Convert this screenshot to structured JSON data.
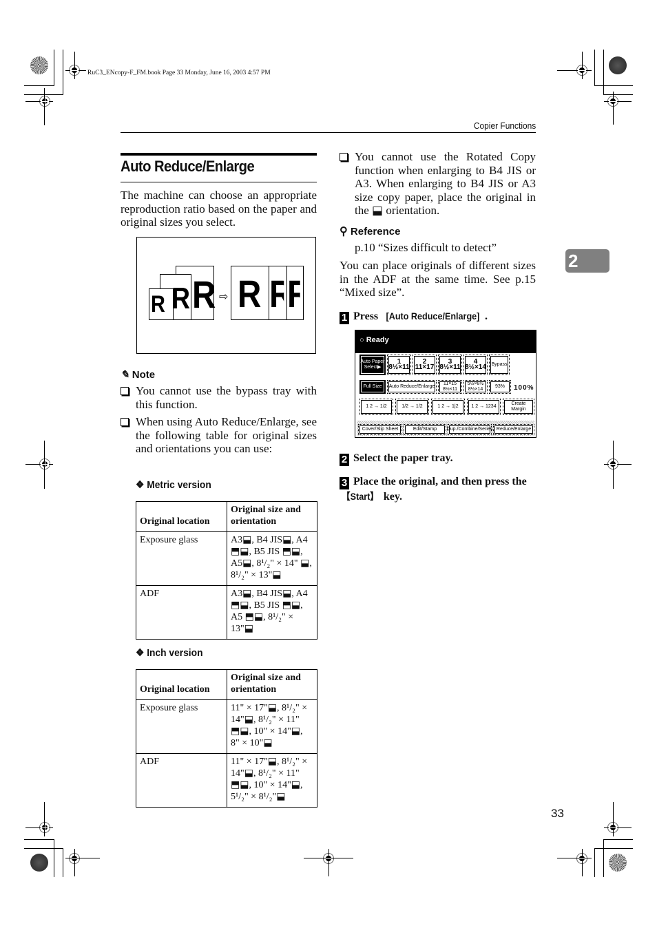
{
  "print_header": {
    "file_info": "RuC3_ENcopy-F_FM.book  Page 33  Monday, June 16, 2003  4:57 PM"
  },
  "running_head": "Copier Functions",
  "chapter_tab": "2",
  "page_number": "33",
  "section": {
    "title": "Auto Reduce/Enlarge",
    "intro": "The machine can choose an appropriate reproduction ratio based on the paper and original sizes you select."
  },
  "figure": {
    "letters": [
      "R",
      "R",
      "R",
      "R",
      "R",
      "R"
    ],
    "arrow": "⇨"
  },
  "note": {
    "label": "Note",
    "items": [
      "You cannot use the bypass tray with this function.",
      "When using Auto Reduce/Enlarge, see the following table for original sizes and orientations you can use:"
    ]
  },
  "metric_table": {
    "heading": "Metric version",
    "columns": [
      "Original location",
      "Original size and orientation"
    ],
    "rows": [
      {
        "location": "Exposure glass",
        "sizes": "A3⬓, B4 JIS⬓, A4 ⬒⬓, B5 JIS ⬒⬓, A5⬓, 8¹/₂\" × 14\" ⬓, 8¹/₂\" × 13\"⬓"
      },
      {
        "location": "ADF",
        "sizes": "A3⬓, B4 JIS⬓, A4 ⬒⬓, B5 JIS ⬒⬓, A5 ⬒⬓, 8¹/₂\" × 13\"⬓"
      }
    ]
  },
  "inch_table": {
    "heading": "Inch version",
    "columns": [
      "Original location",
      "Original size and orientation"
    ],
    "rows": [
      {
        "location": "Exposure glass",
        "sizes": "11\" × 17\"⬓, 8¹/₂\" × 14\"⬓, 8¹/₂\" × 11\" ⬒⬓, 10\" × 14\"⬓, 8\" × 10\"⬓"
      },
      {
        "location": "ADF",
        "sizes": "11\" × 17\"⬓, 8¹/₂\" × 14\"⬓, 8¹/₂\" × 11\" ⬒⬓, 10\" × 14\"⬓, 5¹/₂\" × 8¹/₂\"⬓"
      }
    ]
  },
  "right_note": "You cannot use the Rotated Copy function when enlarging to B4 JIS or A3. When enlarging to B4 JIS or A3 size copy paper, place the original in the ⬓ orientation.",
  "reference": {
    "label": "Reference",
    "link": "p.10 “Sizes difficult to detect”"
  },
  "mixed_text": "You can place originals of different sizes in the ADF at the same time. See p.15 “Mixed size”.",
  "steps": [
    {
      "num": "1",
      "prefix": "Press ",
      "key": "[Auto Reduce/Enlarge]",
      "suffix": "."
    },
    {
      "num": "2",
      "text": "Select the paper tray."
    },
    {
      "num": "3",
      "prefix": "Place the original, and then press the ",
      "key": "【Start】",
      "suffix": " key."
    }
  ],
  "panel": {
    "status": "○ Ready",
    "row1": [
      "Auto Paper Select▶",
      "1 8½×11",
      "2 11×17",
      "3 8½×11",
      "4 8½×14",
      "Bypass"
    ],
    "row2": [
      "Full Size",
      "Auto Reduce/Enlarge",
      "11×15 8½×11",
      "5½×8½ 8½×14",
      "93%"
    ],
    "ratio": "100%",
    "row3": [
      "1 2 → 1/2",
      "1/2 → 1/2",
      "1 2 → 1|2",
      "1 2 → 1234",
      "Create Margin"
    ],
    "row4": [
      "Cover/Slip Sheet",
      "Edit/Stamp",
      "Dup./Combine/Series",
      "Reduce/Enlarge"
    ]
  }
}
